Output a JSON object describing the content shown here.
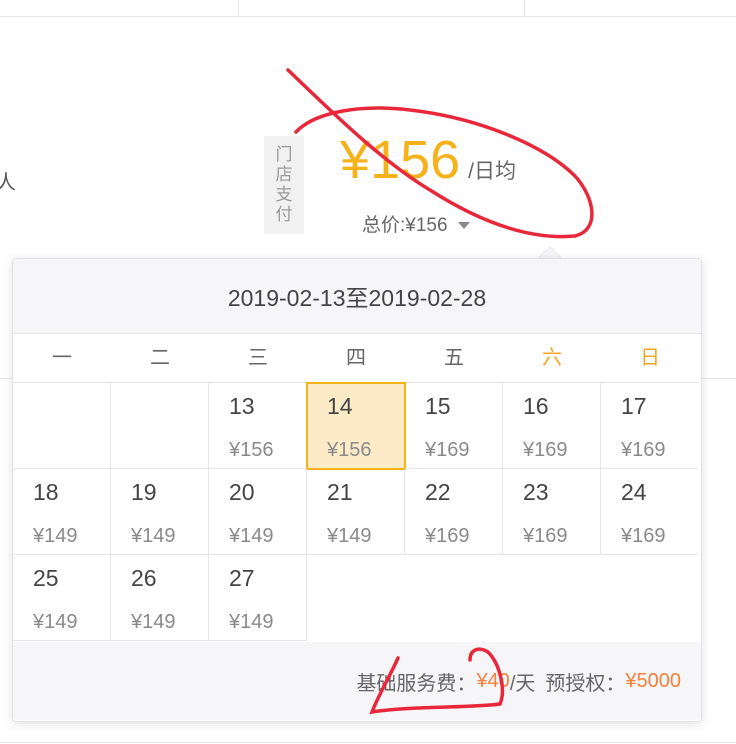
{
  "left_partial_text": "人",
  "store_badge": [
    "门",
    "店",
    "支",
    "付"
  ],
  "price": {
    "main": "¥156",
    "unit": "/日均",
    "total": "总价:¥156"
  },
  "calendar": {
    "range": "2019-02-13至2019-02-28",
    "weekdays": [
      "一",
      "二",
      "三",
      "四",
      "五",
      "六",
      "日"
    ],
    "weekend_color": "#f5a623",
    "selected_color": "#fdebc8",
    "rows": [
      [
        null,
        null,
        {
          "day": "13",
          "price": "¥156"
        },
        {
          "day": "14",
          "price": "¥156",
          "selected": true
        },
        {
          "day": "15",
          "price": "¥169"
        },
        {
          "day": "16",
          "price": "¥169"
        },
        {
          "day": "17",
          "price": "¥169"
        }
      ],
      [
        {
          "day": "18",
          "price": "¥149"
        },
        {
          "day": "19",
          "price": "¥149"
        },
        {
          "day": "20",
          "price": "¥149"
        },
        {
          "day": "21",
          "price": "¥149"
        },
        {
          "day": "22",
          "price": "¥169"
        },
        {
          "day": "23",
          "price": "¥169"
        },
        {
          "day": "24",
          "price": "¥169"
        }
      ],
      [
        {
          "day": "25",
          "price": "¥149"
        },
        {
          "day": "26",
          "price": "¥149"
        },
        {
          "day": "27",
          "price": "¥149"
        }
      ]
    ],
    "footer": {
      "service_label": "基础服务费：",
      "service_value": "¥40",
      "service_unit": "/天",
      "deposit_label": "预授权：",
      "deposit_value": "¥5000",
      "accent_color": "#f5803e"
    }
  },
  "annotation_color": "#e8283a"
}
